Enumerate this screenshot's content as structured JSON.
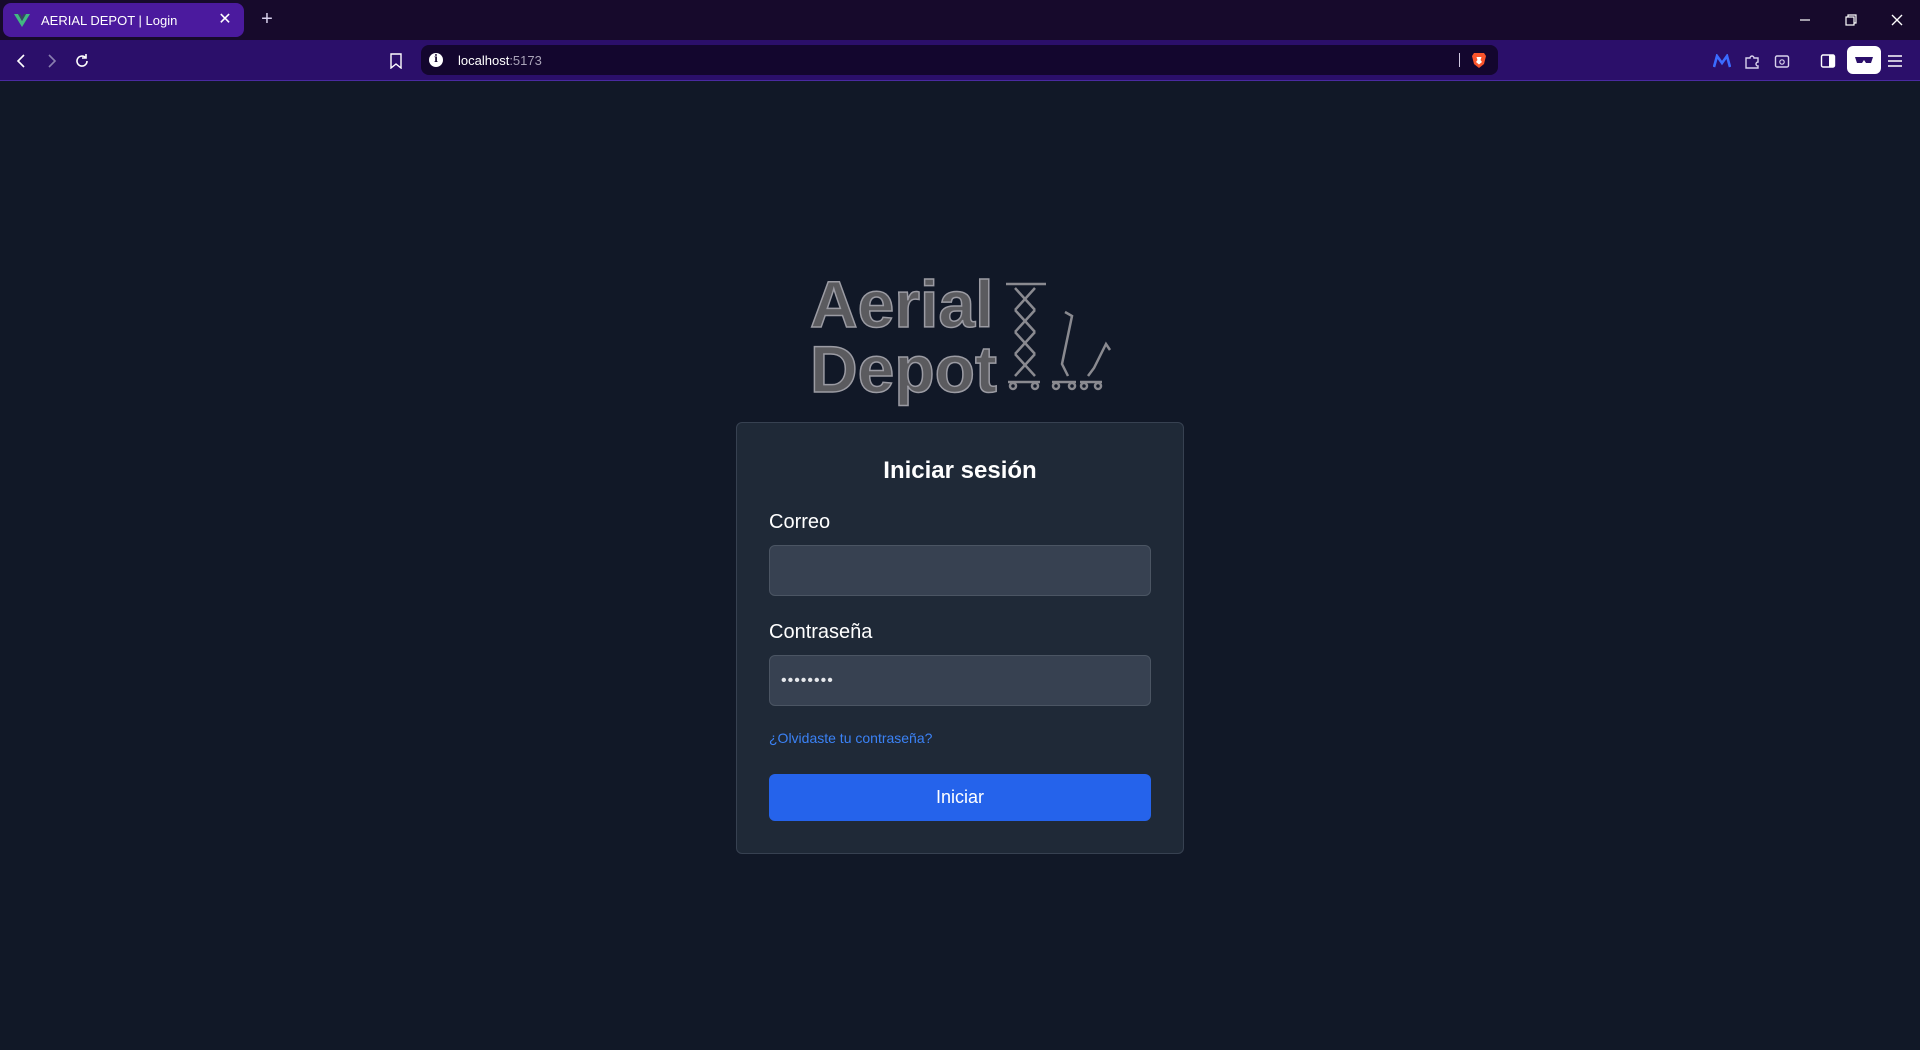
{
  "browser": {
    "tab": {
      "title": "AERIAL DEPOT | Login",
      "favicon": "vue-logo-icon"
    },
    "url": {
      "host": "localhost",
      "port": ":5173"
    },
    "icons": [
      "back-icon",
      "forward-icon",
      "reload-icon",
      "bookmark-icon",
      "site-info-icon",
      "brave-shields-icon",
      "extension-icon",
      "puzzle-icon",
      "tab-search-icon",
      "sidebar-icon",
      "vpn-icon",
      "menu-icon"
    ]
  },
  "logo": {
    "line1": "Aerial",
    "line2": "Depot"
  },
  "login": {
    "title": "Iniciar sesión",
    "email_label": "Correo",
    "email_value": "",
    "password_label": "Contraseña",
    "password_value": "••••••••",
    "forgot_link": "¿Olvidaste tu contraseña?",
    "submit_label": "Iniciar"
  },
  "colors": {
    "page_bg": "#111827",
    "card_bg": "#1f2937",
    "accent": "#2563eb",
    "link": "#3b82f6"
  }
}
